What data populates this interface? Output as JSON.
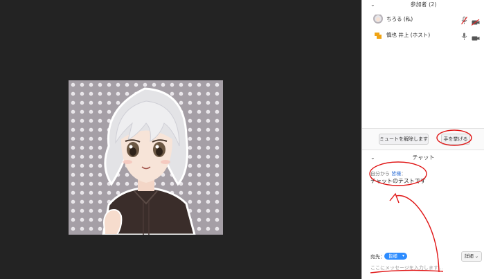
{
  "participants": {
    "header": "参加者 (2)",
    "list": [
      {
        "name": "ちろる (私)",
        "mic": "muted",
        "video": "off",
        "avatar": "anime-avatar"
      },
      {
        "name": "慎也 井上 (ホスト)",
        "mic": "on",
        "video": "on",
        "avatar": "host-avatar"
      }
    ],
    "unmute_label": "ミュートを解除します",
    "raise_hand_label": "手を挙げる"
  },
  "chat": {
    "header": "チャット",
    "messages": [
      {
        "from_prefix": "自分から",
        "to": "皆様",
        "text": "チャットのテストです"
      }
    ],
    "to_label": "宛先：",
    "to_value": "皆様",
    "detail_label": "詳細",
    "input_placeholder": "ここにメッセージを入力します..."
  },
  "colors": {
    "accent": "#2d8cff",
    "annotation": "#e01515",
    "video_bg": "#232323"
  }
}
